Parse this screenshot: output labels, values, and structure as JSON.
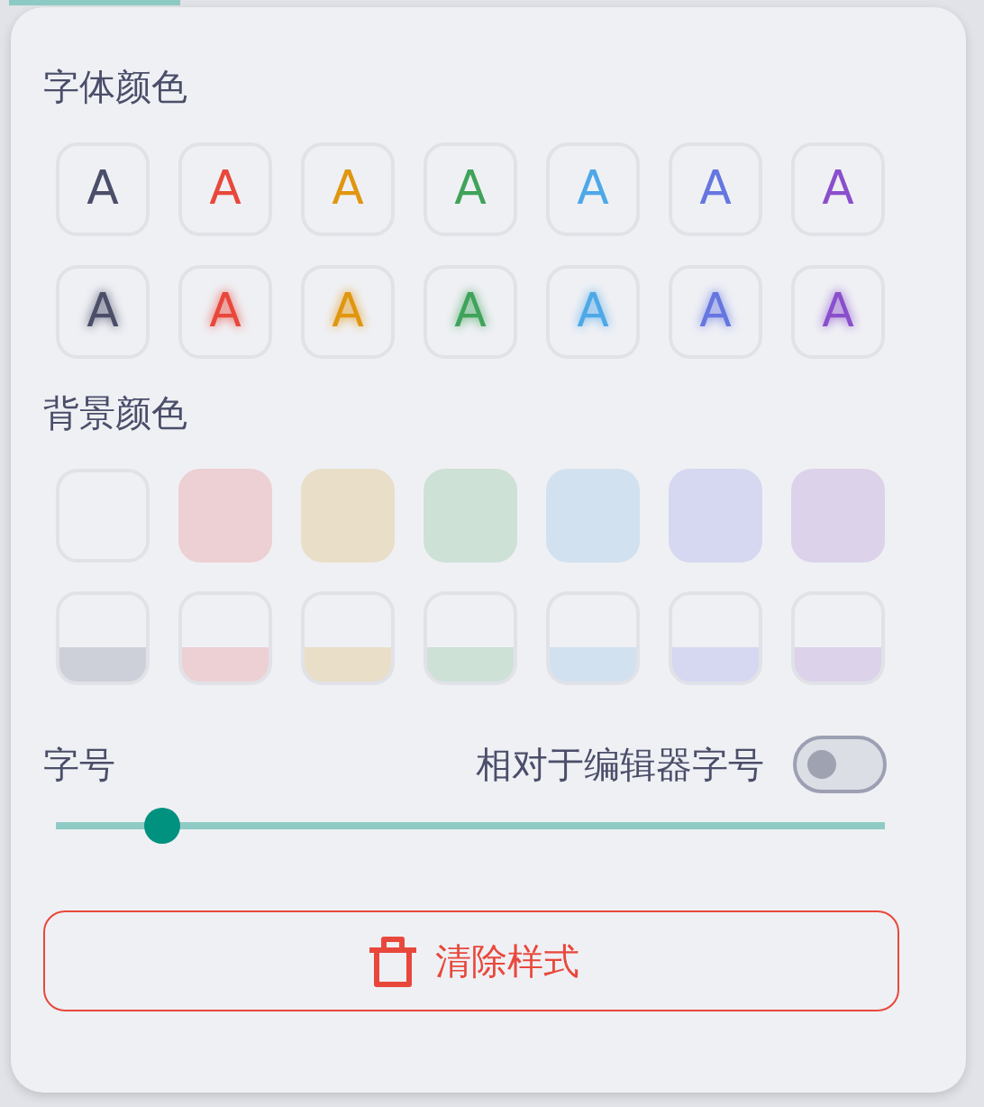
{
  "font_color": {
    "title": "字体颜色",
    "rows": [
      {
        "kind": "plain",
        "items": [
          {
            "label": "A",
            "color": "#4a4e69"
          },
          {
            "label": "A",
            "color": "#e8483b"
          },
          {
            "label": "A",
            "color": "#e0960f"
          },
          {
            "label": "A",
            "color": "#3fa35a"
          },
          {
            "label": "A",
            "color": "#4ea8e8"
          },
          {
            "label": "A",
            "color": "#6676e0"
          },
          {
            "label": "A",
            "color": "#8a4fcc"
          }
        ]
      },
      {
        "kind": "glow",
        "items": [
          {
            "label": "A",
            "color": "#4a4e69"
          },
          {
            "label": "A",
            "color": "#e8483b"
          },
          {
            "label": "A",
            "color": "#e0960f"
          },
          {
            "label": "A",
            "color": "#3fa35a"
          },
          {
            "label": "A",
            "color": "#4ea8e8"
          },
          {
            "label": "A",
            "color": "#6676e0"
          },
          {
            "label": "A",
            "color": "#8a4fcc"
          }
        ]
      }
    ]
  },
  "background_color": {
    "title": "背景颜色",
    "rows": [
      {
        "kind": "fill",
        "items": [
          {
            "kind": "empty"
          },
          {
            "kind": "color",
            "color": "#edd0d3"
          },
          {
            "kind": "color",
            "color": "#e9dec8"
          },
          {
            "kind": "color",
            "color": "#cde1d6"
          },
          {
            "kind": "color",
            "color": "#d1e1f0"
          },
          {
            "kind": "color",
            "color": "#d5d8f0"
          },
          {
            "kind": "color",
            "color": "#dcd2ea"
          }
        ]
      },
      {
        "kind": "band",
        "items": [
          {
            "color": "#cdd0d9"
          },
          {
            "color": "#edd0d3"
          },
          {
            "color": "#e9dec8"
          },
          {
            "color": "#cde1d6"
          },
          {
            "color": "#d1e1f0"
          },
          {
            "color": "#d5d8f0"
          },
          {
            "color": "#dcd2ea"
          }
        ]
      }
    ]
  },
  "font_size": {
    "label": "字号",
    "relative_label": "相对于编辑器字号",
    "relative_on": false,
    "level": 0.128
  },
  "clear_button": {
    "label": "清除样式"
  }
}
